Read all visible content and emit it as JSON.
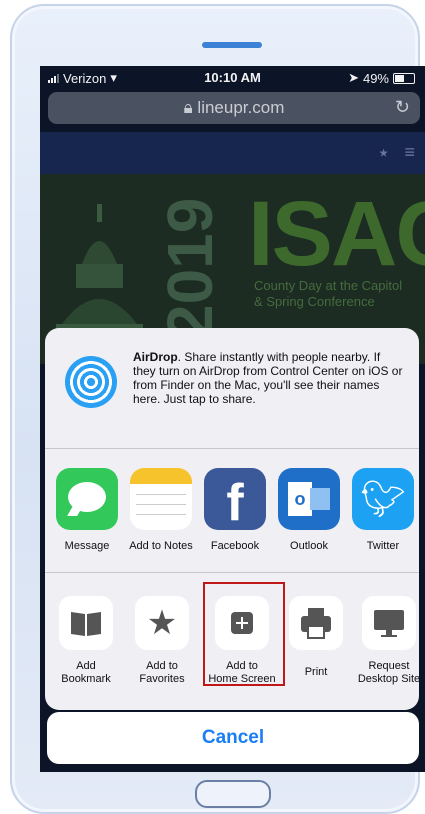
{
  "status_bar": {
    "carrier": "Verizon",
    "time": "10:10 AM",
    "battery": "49%"
  },
  "url_bar": {
    "domain": "lineupr.com"
  },
  "hero": {
    "year": "2019",
    "title": "ISAC",
    "subtitle_line1": "County Day at the Capitol",
    "subtitle_line2": "& Spring Conference"
  },
  "airdrop": {
    "bold": "AirDrop",
    "text": ". Share instantly with people nearby. If they turn on AirDrop from Control Center on iOS or from Finder on the Mac, you'll see their names here. Just tap to share."
  },
  "apps": [
    {
      "label": "Message",
      "icon": "message-icon"
    },
    {
      "label": "Add to Notes",
      "icon": "notes-icon"
    },
    {
      "label": "Facebook",
      "icon": "facebook-icon"
    },
    {
      "label": "Outlook",
      "icon": "outlook-icon"
    },
    {
      "label": "Twitter",
      "icon": "twitter-icon"
    }
  ],
  "actions": [
    {
      "label_line1": "Add",
      "label_line2": "Bookmark",
      "icon": "book-icon"
    },
    {
      "label_line1": "Add to",
      "label_line2": "Favorites",
      "icon": "star-icon"
    },
    {
      "label_line1": "Add to",
      "label_line2": "Home Screen",
      "icon": "plus-square-icon"
    },
    {
      "label_line1": "Print",
      "label_line2": "",
      "icon": "printer-icon"
    },
    {
      "label_line1": "Request",
      "label_line2": "Desktop Site",
      "icon": "desktop-icon"
    }
  ],
  "cancel_label": "Cancel",
  "colors": {
    "accent": "#1a7ef5",
    "highlight": "#c01818"
  }
}
